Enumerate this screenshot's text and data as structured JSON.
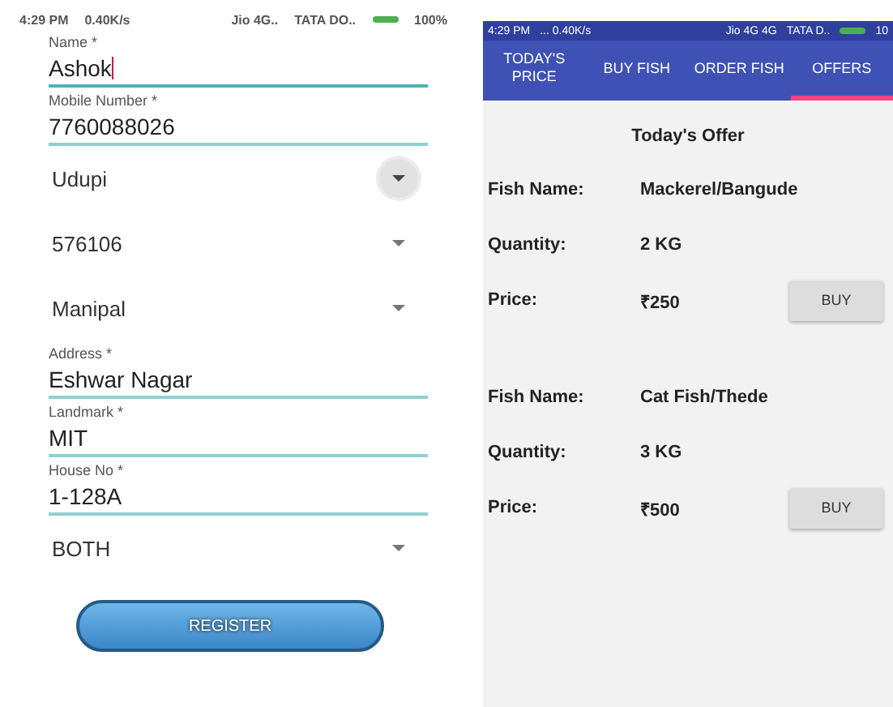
{
  "left_screen": {
    "status_bar": {
      "time": "4:29 PM",
      "speed": "0.40K/s",
      "carrier_1": "Jio 4G..",
      "carrier_2": "TATA DO..",
      "battery": "100%"
    },
    "fields": [
      {
        "kind": "text",
        "label": "Name *",
        "value": "Ashok",
        "focused": true
      },
      {
        "kind": "text",
        "label": "Mobile Number *",
        "value": "7760088026",
        "focused": false
      },
      {
        "kind": "dropdown",
        "value": "Udupi",
        "pressed": true
      },
      {
        "kind": "dropdown",
        "value": "576106",
        "pressed": false
      },
      {
        "kind": "dropdown",
        "value": "Manipal",
        "pressed": false
      },
      {
        "kind": "text",
        "label": "Address *",
        "value": "Eshwar Nagar",
        "focused": false
      },
      {
        "kind": "text",
        "label": "Landmark *",
        "value": "MIT",
        "focused": false
      },
      {
        "kind": "text",
        "label": "House No *",
        "value": "1-128A",
        "focused": false
      },
      {
        "kind": "dropdown",
        "value": "BOTH",
        "pressed": false
      }
    ],
    "register_button": "REGISTER"
  },
  "right_screen": {
    "status_bar": {
      "time": "4:29 PM",
      "speed": "... 0.40K/s",
      "carrier_1": "Jio 4G 4G",
      "carrier_2": "TATA D..",
      "battery": "10"
    },
    "tabs": [
      {
        "label": "TODAY'S PRICE",
        "selected": false
      },
      {
        "label": "BUY FISH",
        "selected": false
      },
      {
        "label": "ORDER FISH",
        "selected": false
      },
      {
        "label": "OFFERS",
        "selected": true
      }
    ],
    "title": "Today's Offer",
    "offers": [
      {
        "name_label": "Fish Name:",
        "name": "Mackerel/Bangude",
        "quantity_label": "Quantity:",
        "quantity": "2 KG",
        "price_label": "Price:",
        "price": "₹250",
        "button": "BUY"
      },
      {
        "name_label": "Fish Name:",
        "name": "Cat Fish/Thede",
        "quantity_label": "Quantity:",
        "quantity": "3 KG",
        "price_label": "Price:",
        "price": "₹500",
        "button": "BUY"
      }
    ]
  }
}
